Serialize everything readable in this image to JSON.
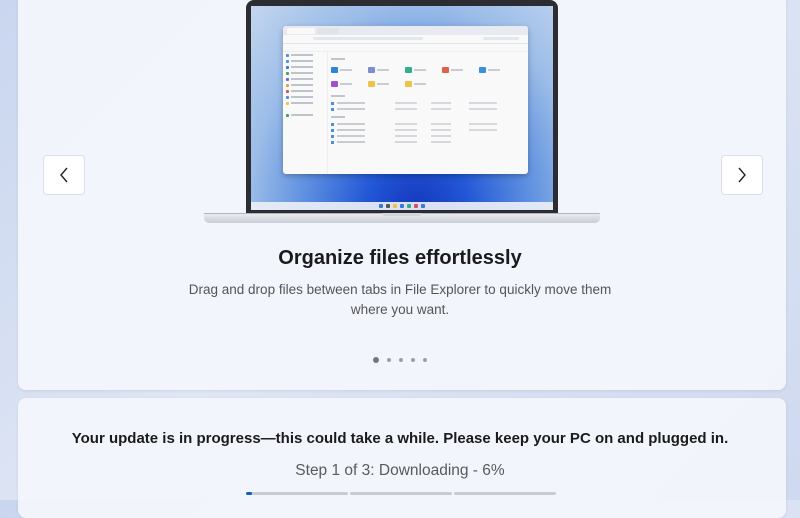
{
  "carousel": {
    "prev_icon": "chevron-left-icon",
    "next_icon": "chevron-right-icon",
    "slide_title": "Organize files effortlessly",
    "slide_description": "Drag and drop files between tabs in File Explorer to quickly move them where you want.",
    "slide_count": 5,
    "active_index": 0
  },
  "update": {
    "message": "Your update is in progress—this could take a while. Please keep your PC on and plugged in.",
    "step_text": "Step 1 of 3: Downloading - 6%",
    "steps_total": 3,
    "current_step": 1,
    "current_step_progress": 0.06,
    "accent_color": "#0f5fc2"
  }
}
